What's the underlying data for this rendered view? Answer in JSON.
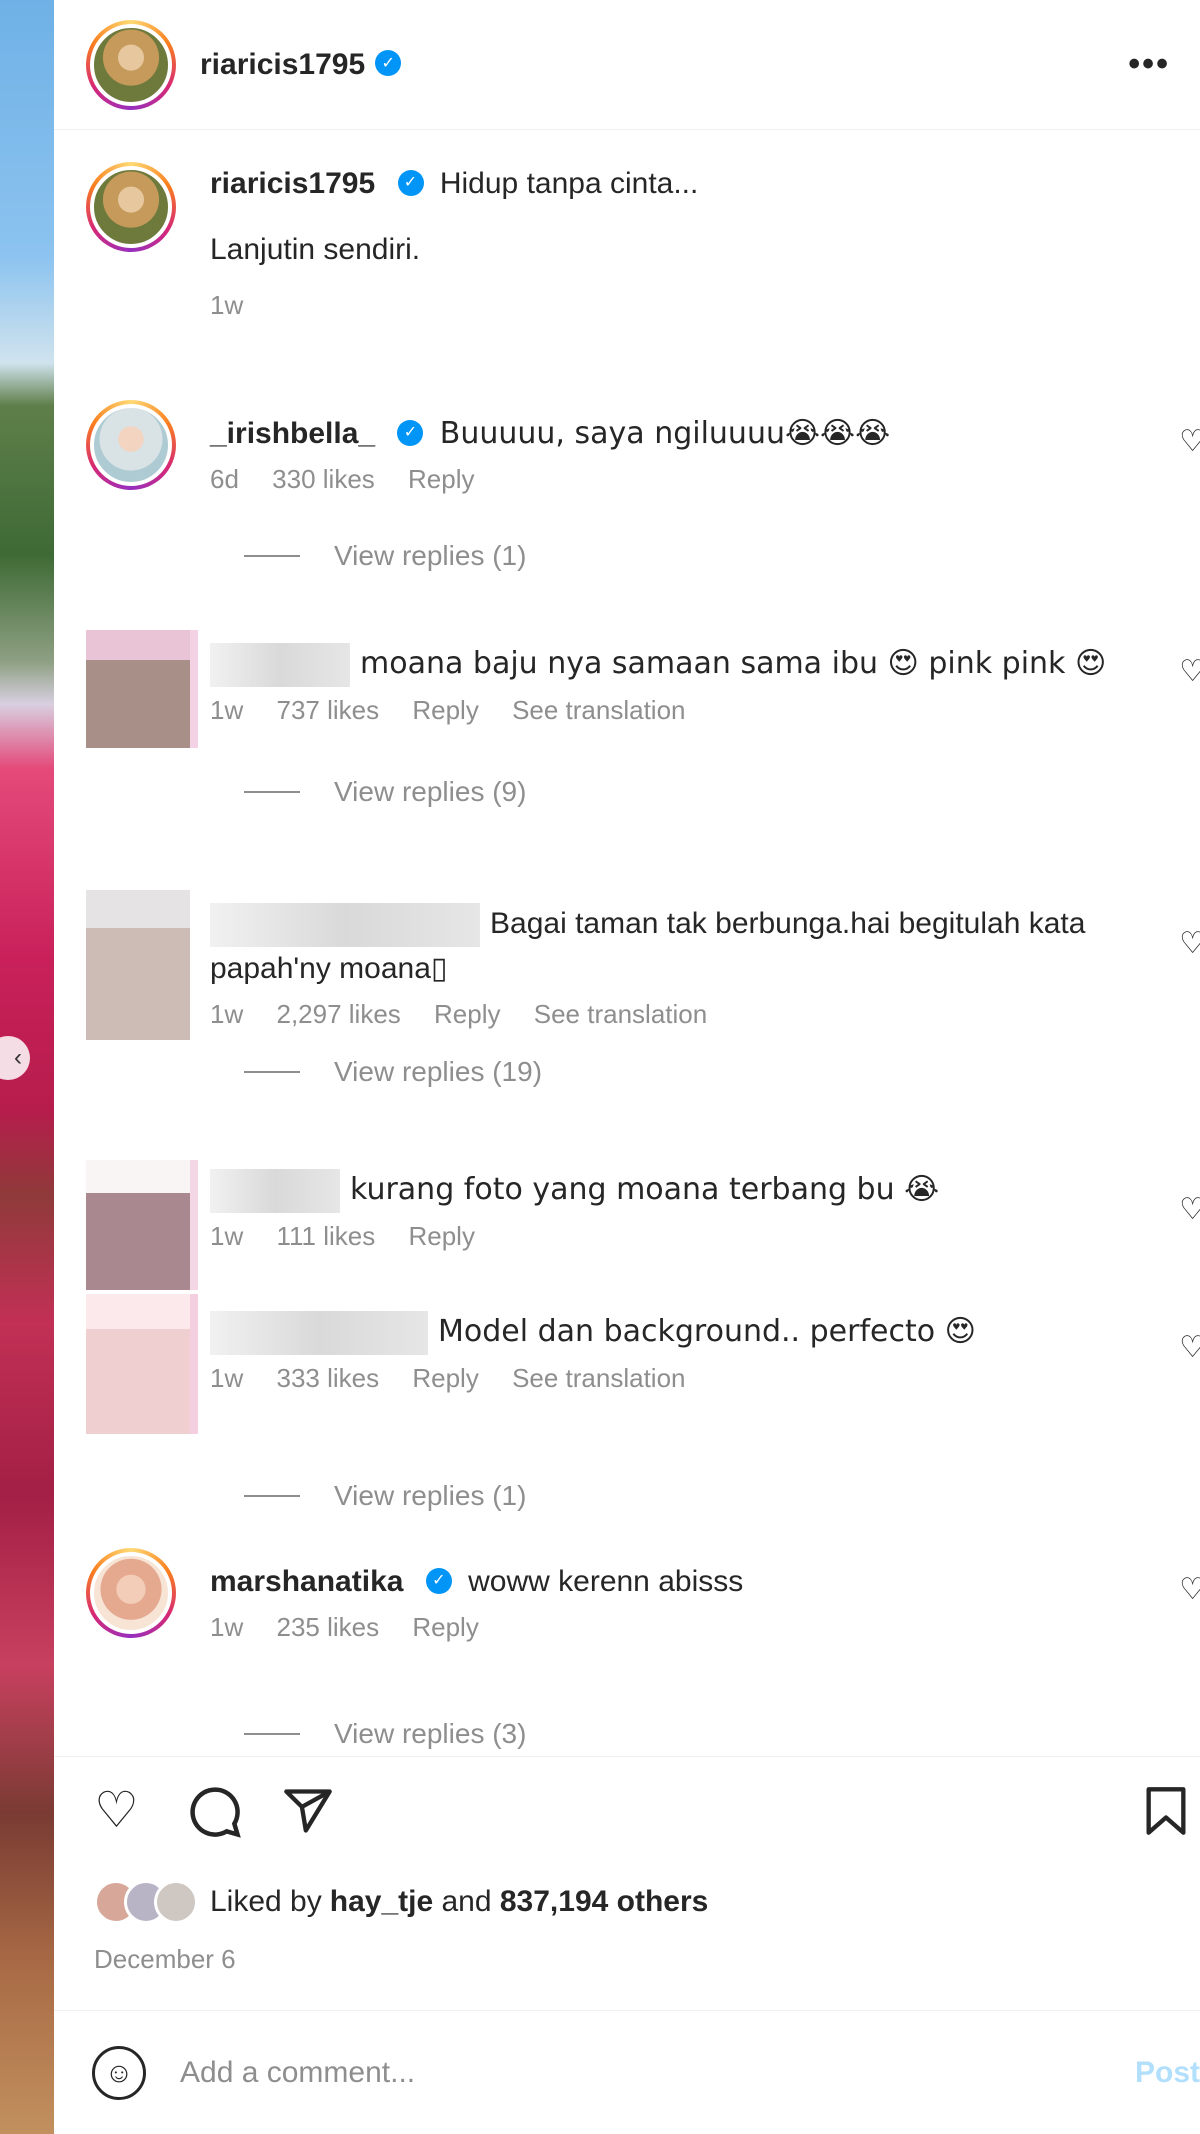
{
  "header": {
    "username": "riaricis1795",
    "more_icon": "more-icon",
    "more_label": "•••"
  },
  "caption": {
    "username": "riaricis1795",
    "text": "Hidup tanpa cinta...",
    "text2": "Lanjutin sendiri.",
    "time": "1w"
  },
  "comments": [
    {
      "username": "_irishbella_",
      "verified": true,
      "text": "Buuuuu, saya ngiluuuu😭😭😭",
      "time": "6d",
      "likes": "330 likes",
      "reply": "Reply",
      "view_replies": "View replies (1)"
    },
    {
      "username": "",
      "text": "moana baju nya samaan sama ibu 😍 pink pink 😍",
      "time": "1w",
      "likes": "737 likes",
      "reply": "Reply",
      "translation": "See translation",
      "view_replies": "View replies (9)"
    },
    {
      "username": "",
      "text": "Bagai taman tak berbunga.hai begitulah kata papah'ny moana▯",
      "time": "1w",
      "likes": "2,297 likes",
      "reply": "Reply",
      "translation": "See translation",
      "view_replies": "View replies (19)"
    },
    {
      "username": "",
      "text": "kurang foto yang moana terbang bu 😭",
      "time": "1w",
      "likes": "111 likes",
      "reply": "Reply"
    },
    {
      "username": "",
      "text": "Model dan background.. perfecto 😍",
      "time": "1w",
      "likes": "333 likes",
      "reply": "Reply",
      "translation": "See translation",
      "view_replies": "View replies (1)"
    },
    {
      "username": "marshanatika",
      "verified": true,
      "text": "woww kerenn abisss",
      "time": "1w",
      "likes": "235 likes",
      "reply": "Reply",
      "view_replies": "View replies (3)"
    }
  ],
  "actions": {
    "like_icon": "heart-icon",
    "comment_icon": "comment-icon",
    "share_icon": "share-icon",
    "save_icon": "bookmark-icon"
  },
  "likes": {
    "prefix": "Liked by ",
    "user": "hay_tje",
    "middle": " and ",
    "others": "837,194 others"
  },
  "date": "December 6",
  "add_comment": {
    "placeholder": "Add a comment...",
    "post_label": "Post"
  },
  "colors": {
    "accent": "#0095f6",
    "muted": "#8e8e8e",
    "text": "#262626"
  }
}
